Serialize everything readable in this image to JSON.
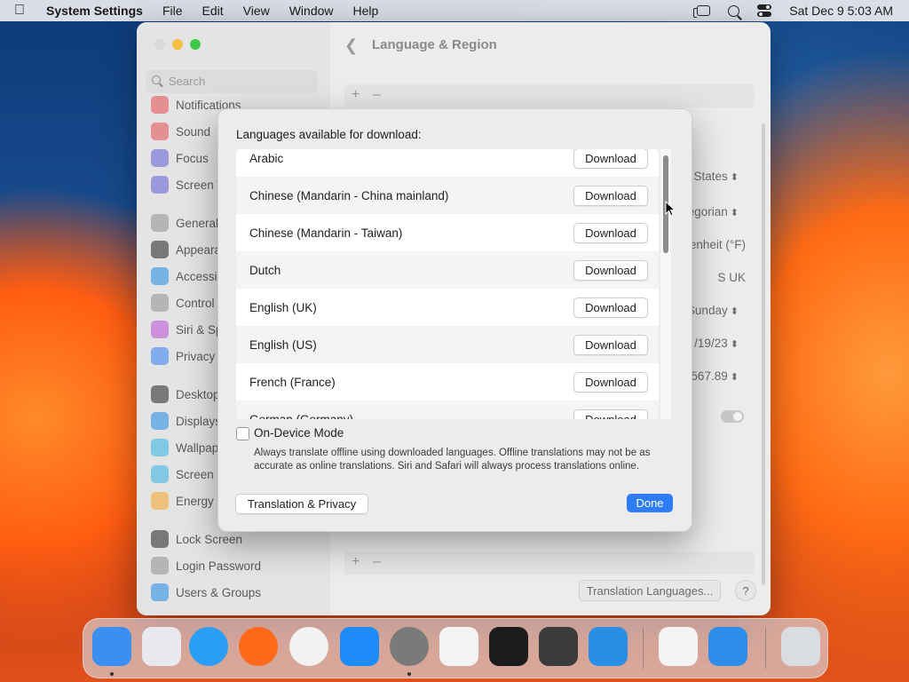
{
  "menubar": {
    "app_name": "System Settings",
    "menus": [
      "File",
      "Edit",
      "View",
      "Window",
      "Help"
    ],
    "clock": "Sat Dec 9  5:03 AM"
  },
  "window": {
    "title": "Language & Region",
    "search_placeholder": "Search",
    "sidebar": [
      {
        "label": "Notifications",
        "color": "#e5484d"
      },
      {
        "label": "Sound",
        "color": "#e5484d"
      },
      {
        "label": "Focus",
        "color": "#5b5bd6"
      },
      {
        "label": "Screen T",
        "color": "#5b5bd6"
      },
      {
        "label": "General",
        "color": "#8e8e93"
      },
      {
        "label": "Appeara",
        "color": "#1f1f1f"
      },
      {
        "label": "Accessi",
        "color": "#1e88e5"
      },
      {
        "label": "Control",
        "color": "#8e8e93"
      },
      {
        "label": "Siri & Sp",
        "color": "#b84bd9"
      },
      {
        "label": "Privacy",
        "color": "#2f7df6"
      },
      {
        "label": "Desktop",
        "color": "#1f1f1f"
      },
      {
        "label": "Displays",
        "color": "#1e88e5"
      },
      {
        "label": "Wallpap",
        "color": "#30b0e0"
      },
      {
        "label": "Screen S",
        "color": "#30b0e0"
      },
      {
        "label": "Energy S",
        "color": "#f5a623"
      },
      {
        "label": "Lock Screen",
        "color": "#1f1f1f"
      },
      {
        "label": "Login Password",
        "color": "#8e8e93"
      },
      {
        "label": "Users & Groups",
        "color": "#1e88e5"
      }
    ],
    "background_values": [
      {
        "label": "States",
        "has_arrows": true
      },
      {
        "label": "egorian",
        "has_arrows": true
      },
      {
        "label": "enheit (°F)",
        "has_arrows": false
      },
      {
        "label": "S      UK",
        "has_arrows": false
      },
      {
        "label": "Sunday",
        "has_arrows": true
      },
      {
        "label": "/19/23",
        "has_arrows": true
      },
      {
        "label": "567.89",
        "has_arrows": true
      }
    ],
    "translation_languages_button": "Translation Languages...",
    "help_button": "?"
  },
  "sheet": {
    "title": "Languages available for download:",
    "languages": [
      {
        "name": "Arabic",
        "button": "Download"
      },
      {
        "name": "Chinese (Mandarin - China mainland)",
        "button": "Download"
      },
      {
        "name": "Chinese (Mandarin - Taiwan)",
        "button": "Download"
      },
      {
        "name": "Dutch",
        "button": "Download"
      },
      {
        "name": "English (UK)",
        "button": "Download"
      },
      {
        "name": "English (US)",
        "button": "Download"
      },
      {
        "name": "French (France)",
        "button": "Download"
      },
      {
        "name": "German (Germany)",
        "button": "Download"
      }
    ],
    "on_device_mode": {
      "label": "On-Device Mode",
      "checked": false,
      "description": "Always translate offline using downloaded languages. Offline translations may not be as accurate as online translations. Siri and Safari will always process translations online."
    },
    "privacy_button": "Translation & Privacy",
    "done_button": "Done",
    "accent_color": "#2f7df6"
  },
  "dock": [
    {
      "name": "finder",
      "color": "#3a8ff0",
      "running": true
    },
    {
      "name": "launchpad",
      "color": "#e8e8ee",
      "running": false
    },
    {
      "name": "safari",
      "color": "#2a9df4",
      "running": false
    },
    {
      "name": "firefox",
      "color": "#ff6a1a",
      "running": false
    },
    {
      "name": "chrome",
      "color": "#f2f2f2",
      "running": false
    },
    {
      "name": "app-store",
      "color": "#1d8cf8",
      "running": false
    },
    {
      "name": "system-settings",
      "color": "#7a7a7a",
      "running": true
    },
    {
      "name": "textedit",
      "color": "#f4f4f4",
      "running": false
    },
    {
      "name": "terminal",
      "color": "#1c1c1c",
      "running": false
    },
    {
      "name": "garageband",
      "color": "#3b3b3b",
      "running": false
    },
    {
      "name": "vscode",
      "color": "#2a8ee6",
      "running": false
    },
    {
      "name": "visual-studio",
      "color": "#f4f4f6",
      "running": false
    },
    {
      "name": "weather",
      "color": "#2d8de8",
      "running": false
    },
    {
      "name": "trash",
      "color": "#d9dde2",
      "running": false
    }
  ]
}
